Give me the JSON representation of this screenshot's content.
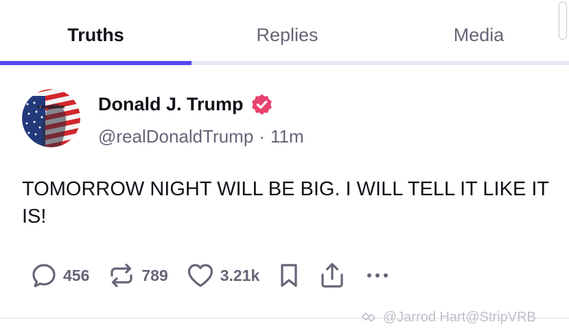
{
  "tabs": [
    {
      "label": "Truths",
      "active": true
    },
    {
      "label": "Replies",
      "active": false
    },
    {
      "label": "Media",
      "active": false
    }
  ],
  "post": {
    "author": {
      "display_name": "Donald J. Trump",
      "handle": "@realDonaldTrump",
      "verified": true
    },
    "separator": "·",
    "time": "11m",
    "text": "TOMORROW NIGHT WILL BE BIG. I WILL TELL IT LIKE IT IS!",
    "actions": {
      "replies": "456",
      "retruths": "789",
      "likes": "3.21k"
    }
  },
  "watermark": {
    "text": "@Jarrod Hart@StripVRB"
  },
  "colors": {
    "accent": "#5448ee",
    "verified_badge": "#e8436f",
    "muted_text": "#656577",
    "primary_text": "#111119"
  }
}
